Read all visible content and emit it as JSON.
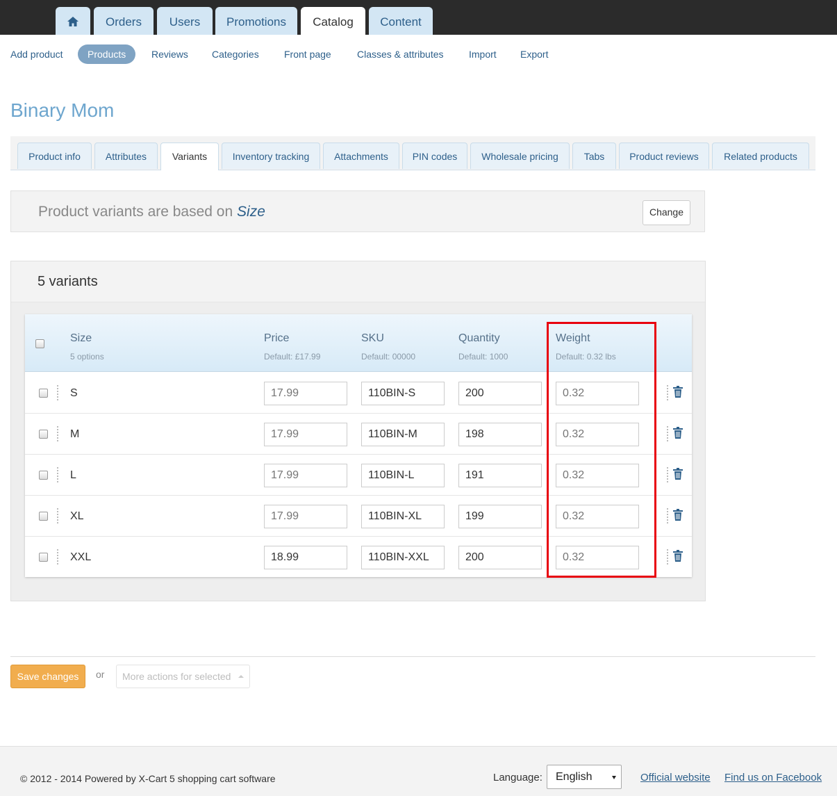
{
  "top_nav": {
    "tabs": [
      {
        "label": "",
        "icon": "home-icon"
      },
      {
        "label": "Orders"
      },
      {
        "label": "Users"
      },
      {
        "label": "Promotions"
      },
      {
        "label": "Catalog",
        "active": true
      },
      {
        "label": "Content"
      }
    ]
  },
  "sub_nav": {
    "items": [
      {
        "label": "Add product"
      },
      {
        "label": "Products",
        "active": true
      },
      {
        "label": "Reviews"
      },
      {
        "label": "Categories"
      },
      {
        "label": "Front page"
      },
      {
        "label": "Classes & attributes"
      },
      {
        "label": "Import"
      },
      {
        "label": "Export"
      }
    ]
  },
  "page": {
    "title": "Binary Mom"
  },
  "product_tabs": [
    {
      "label": "Product info"
    },
    {
      "label": "Attributes"
    },
    {
      "label": "Variants",
      "active": true
    },
    {
      "label": "Inventory tracking"
    },
    {
      "label": "Attachments"
    },
    {
      "label": "PIN codes"
    },
    {
      "label": "Wholesale pricing"
    },
    {
      "label": "Tabs"
    },
    {
      "label": "Product reviews"
    },
    {
      "label": "Related products"
    }
  ],
  "based_on": {
    "text": "Product variants are based on",
    "attribute": "Size",
    "change_label": "Change"
  },
  "variants": {
    "title": "5 variants",
    "columns": {
      "size": {
        "label": "Size",
        "sub": "5 options"
      },
      "price": {
        "label": "Price",
        "sub": "Default: £17.99"
      },
      "sku": {
        "label": "SKU",
        "sub": "Default: 00000"
      },
      "quantity": {
        "label": "Quantity",
        "sub": "Default: 1000"
      },
      "weight": {
        "label": "Weight",
        "sub": "Default: 0.32 lbs"
      }
    },
    "rows": [
      {
        "size": "S",
        "price": "",
        "price_placeholder": "17.99",
        "sku": "110BIN-S",
        "quantity": "200",
        "weight": "",
        "weight_placeholder": "0.32"
      },
      {
        "size": "M",
        "price": "",
        "price_placeholder": "17.99",
        "sku": "110BIN-M",
        "quantity": "198",
        "weight": "",
        "weight_placeholder": "0.32"
      },
      {
        "size": "L",
        "price": "",
        "price_placeholder": "17.99",
        "sku": "110BIN-L",
        "quantity": "191",
        "weight": "",
        "weight_placeholder": "0.32"
      },
      {
        "size": "XL",
        "price": "",
        "price_placeholder": "17.99",
        "sku": "110BIN-XL",
        "quantity": "199",
        "weight": "",
        "weight_placeholder": "0.32"
      },
      {
        "size": "XXL",
        "price": "18.99",
        "price_placeholder": "17.99",
        "sku": "110BIN-XXL",
        "quantity": "200",
        "weight": "",
        "weight_placeholder": "0.32"
      }
    ]
  },
  "actions": {
    "save_label": "Save changes",
    "or_label": "or",
    "more_actions_label": "More actions for selected"
  },
  "footer": {
    "copyright": "© 2012 - 2014 Powered by X-Cart 5 shopping cart software",
    "language_label": "Language:",
    "language_value": "English",
    "official_link": "Official website",
    "facebook_link": "Find us on Facebook"
  },
  "colors": {
    "accent": "#2d5f8a",
    "title": "#6ea6ce",
    "save_button": "#f1ad4e",
    "highlight": "#e8000e"
  }
}
